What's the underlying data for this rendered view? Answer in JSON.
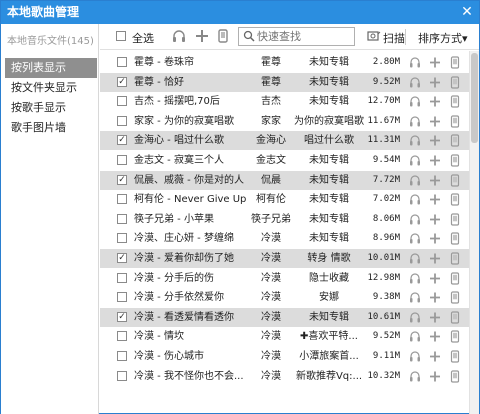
{
  "window": {
    "title": "本地歌曲管理",
    "close": "✕"
  },
  "sidebar": {
    "header": "本地音乐文件(145)",
    "items": [
      {
        "label": "按列表显示",
        "active": true
      },
      {
        "label": "按文件夹显示",
        "active": false
      },
      {
        "label": "按歌手显示",
        "active": false
      },
      {
        "label": "歌手图片墙",
        "active": false
      }
    ]
  },
  "toolbar": {
    "select_all": "全选",
    "search_placeholder": "快速查找",
    "scan_label": "扫描",
    "sort_label": "排序方式▾"
  },
  "songs": [
    {
      "title": "霍尊 - 卷珠帘",
      "artist": "霍尊",
      "album": "未知专辑",
      "size": "2.80M",
      "checked": false
    },
    {
      "title": "霍尊 - 恰好",
      "artist": "霍尊",
      "album": "未知专辑",
      "size": "9.52M",
      "checked": true
    },
    {
      "title": "吉杰 - 摇摆吧,70后",
      "artist": "吉杰",
      "album": "未知专辑",
      "size": "12.70M",
      "checked": false
    },
    {
      "title": "家家 - 为你的寂寞唱歌",
      "artist": "家家",
      "album": "为你的寂寞唱歌",
      "size": "11.67M",
      "checked": false
    },
    {
      "title": "金海心 - 唱过什么歌",
      "artist": "金海心",
      "album": "唱过什么歌",
      "size": "11.31M",
      "checked": true
    },
    {
      "title": "金志文 - 寂寞三个人",
      "artist": "金志文",
      "album": "未知专辑",
      "size": "9.54M",
      "checked": false
    },
    {
      "title": "侃晨、戚薇 - 你是对的人",
      "artist": "侃晨",
      "album": "未知专辑",
      "size": "7.72M",
      "checked": true
    },
    {
      "title": "柯有伦 - Never Give Up",
      "artist": "柯有伦",
      "album": "未知专辑",
      "size": "7.02M",
      "checked": false
    },
    {
      "title": "筷子兄弟 - 小苹果",
      "artist": "筷子兄弟",
      "album": "未知专辑",
      "size": "8.06M",
      "checked": false
    },
    {
      "title": "冷漠、庄心妍 - 梦缠绵",
      "artist": "冷漠",
      "album": "未知专辑",
      "size": "8.96M",
      "checked": false
    },
    {
      "title": "冷漠 - 爱着你却伤了她",
      "artist": "冷漠",
      "album": "转身 情歌",
      "size": "10.01M",
      "checked": true
    },
    {
      "title": "冷漠 - 分手后的伤",
      "artist": "冷漠",
      "album": "隐士收藏",
      "size": "12.98M",
      "checked": false
    },
    {
      "title": "冷漠 - 分手依然爱你",
      "artist": "冷漠",
      "album": "安娜",
      "size": "9.38M",
      "checked": false
    },
    {
      "title": "冷漠 - 看透爱情看透你",
      "artist": "冷漠",
      "album": "未知专辑",
      "size": "10.61M",
      "checked": true
    },
    {
      "title": "冷漠 - 情坎",
      "artist": "冷漠",
      "album": "✚喜欢平特...",
      "size": "9.52M",
      "checked": false
    },
    {
      "title": "冷漠 - 伤心城市",
      "artist": "冷漠",
      "album": "小潭旅案首...",
      "size": "9.11M",
      "checked": false
    },
    {
      "title": "冷漠 - 我不怪你也不会...",
      "artist": "冷漠",
      "album": "新歌推荐Vq:...",
      "size": "10.32M",
      "checked": false
    }
  ],
  "colors": {
    "titlebar": "#2b8ee0",
    "row_checked": "#dcdcdc",
    "sidebar_active": "#8f8f8f"
  }
}
